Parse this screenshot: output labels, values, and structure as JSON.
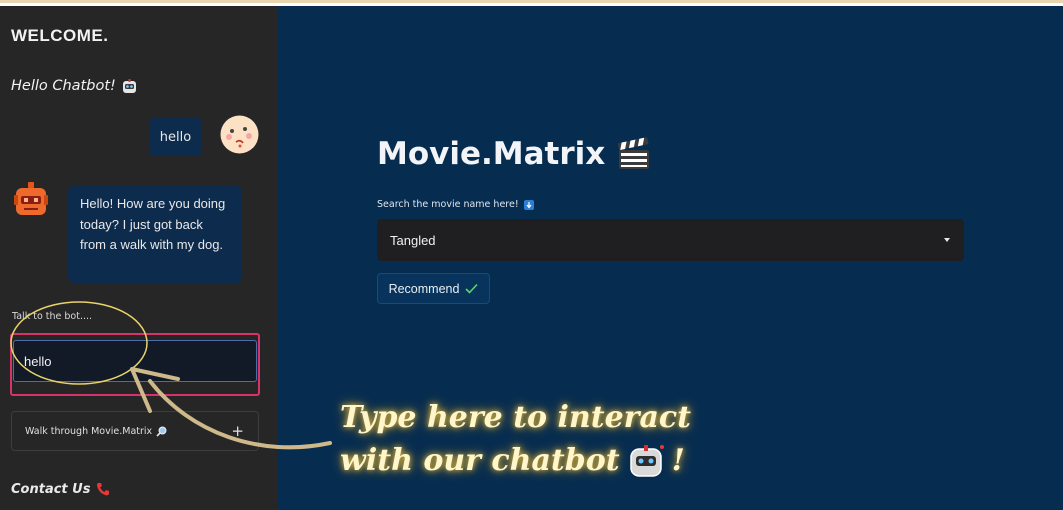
{
  "sidebar": {
    "welcome": "WELCOME.",
    "hello_chatbot": "Hello Chatbot!",
    "chat": [
      {
        "role": "user",
        "text": "hello"
      },
      {
        "role": "bot",
        "text": "Hello! How are you doing today? I just got back from a walk with my dog."
      }
    ],
    "input_label": "Talk to the bot....",
    "input_value": "hello",
    "expander_label": "Walk through Movie.Matrix",
    "expander_icon": "magnifier-icon",
    "expander_toggle": "+",
    "contact": "Contact Us"
  },
  "main": {
    "title": "Movie.Matrix",
    "title_icon": "clapperboard-icon",
    "search_label": "Search the movie name here!",
    "selected_movie": "Tangled",
    "recommend_label": "Recommend",
    "recommend_icon": "check-icon"
  },
  "annotation": {
    "line1": "Type here to interact",
    "line2": "with our chatbot",
    "line2_end": "!"
  },
  "colors": {
    "sidebar_bg": "#262627",
    "main_bg": "#062c50",
    "bubble_bg": "#0d2b4c",
    "input_highlight": "#d6336c",
    "annotation_glow": "#e0b93f"
  }
}
